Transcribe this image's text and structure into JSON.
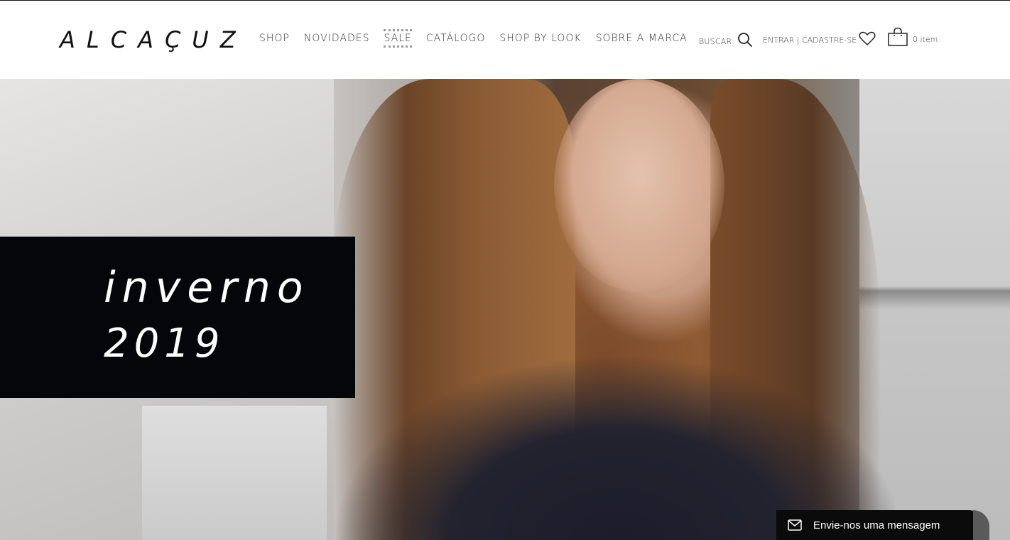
{
  "header": {
    "logo": "ALCAÇUZ",
    "nav": [
      {
        "label": "SHOP"
      },
      {
        "label": "NOVIDADES"
      },
      {
        "label": "SALE"
      },
      {
        "label": "CATÁLOGO"
      },
      {
        "label": "SHOP BY LOOK"
      },
      {
        "label": "SOBRE A MARCA"
      }
    ],
    "search_label": "BUSCAR",
    "login_label": "ENTRAR | CADASTRE-SE",
    "cart_count": "0 item"
  },
  "hero": {
    "title": "inverno",
    "year": "2019"
  },
  "chat": {
    "label": "Envie-nos uma mensagem"
  },
  "icons": {
    "search": "search-icon",
    "wishlist": "heart-icon",
    "cart": "shopping-bag-icon",
    "chat": "envelope-icon"
  },
  "colors": {
    "hero_box": "#05060a",
    "chat_bg": "#0b0b0b",
    "text": "#333333"
  }
}
